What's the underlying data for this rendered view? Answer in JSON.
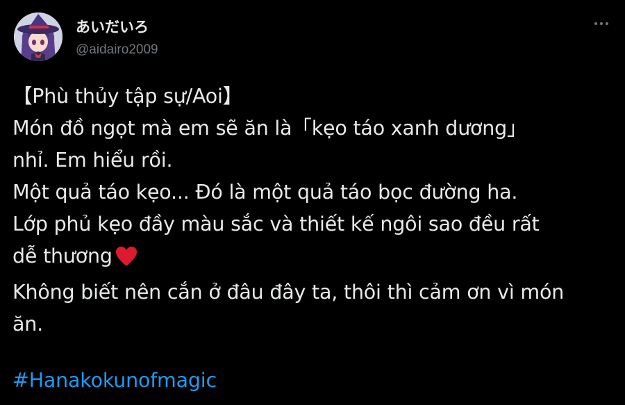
{
  "author": {
    "display_name": "あいだいろ",
    "handle": "@aidairo2009",
    "avatar_icon": "anime-witch-avatar"
  },
  "menu": {
    "more_icon": "more-horizontal-icon"
  },
  "tweet": {
    "lines": [
      "【Phù thủy tập sự/Aoi】",
      "Món đồ ngọt mà em sẽ ăn là「kẹo táo xanh dương」",
      "nhỉ. Em hiểu rồi.",
      "Một quả táo kẹo... Đó là một quả táo bọc đường ha.",
      "Lớp phủ kẹo đầy màu sắc và thiết kế ngôi sao đều rất",
      "dễ thương",
      "Không biết nên cắn ở đâu đây ta, thôi thì cảm ơn vì món",
      "ăn."
    ],
    "emoji": "heart-icon",
    "hashtag": "#Hanakokunofmagic"
  },
  "colors": {
    "background": "#000000",
    "text": "#e7e9ea",
    "secondary": "#71767b",
    "link": "#1d9bf0",
    "heart": "#e0142c"
  }
}
